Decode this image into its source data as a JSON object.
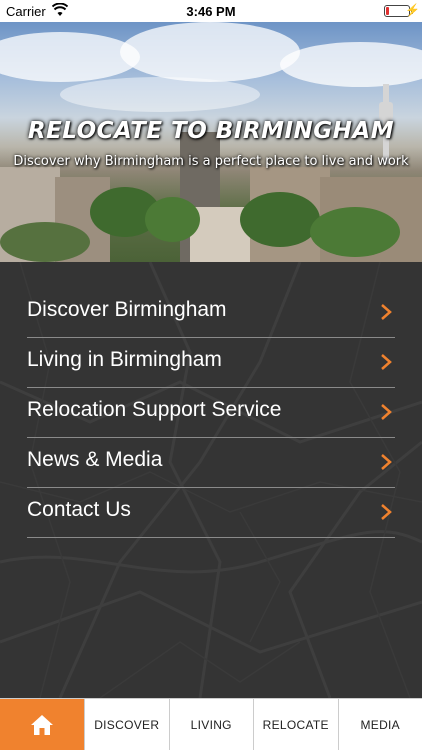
{
  "status_bar": {
    "carrier": "Carrier",
    "time": "3:46 PM",
    "battery_color": "#e03030"
  },
  "hero": {
    "title": "RELOCATE TO BIRMINGHAM",
    "subtitle": "Discover why Birmingham is a perfect place to live and work"
  },
  "menu": {
    "items": [
      {
        "label": "Discover Birmingham"
      },
      {
        "label": "Living in Birmingham"
      },
      {
        "label": "Relocation Support Service"
      },
      {
        "label": "News & Media"
      },
      {
        "label": "Contact Us"
      }
    ],
    "chevron_color": "#f0822e"
  },
  "tab_bar": {
    "home_icon": "home-icon",
    "accent": "#f0822e",
    "tabs": [
      {
        "label": "DISCOVER"
      },
      {
        "label": "LIVING"
      },
      {
        "label": "RELOCATE"
      },
      {
        "label": "MEDIA"
      }
    ]
  }
}
